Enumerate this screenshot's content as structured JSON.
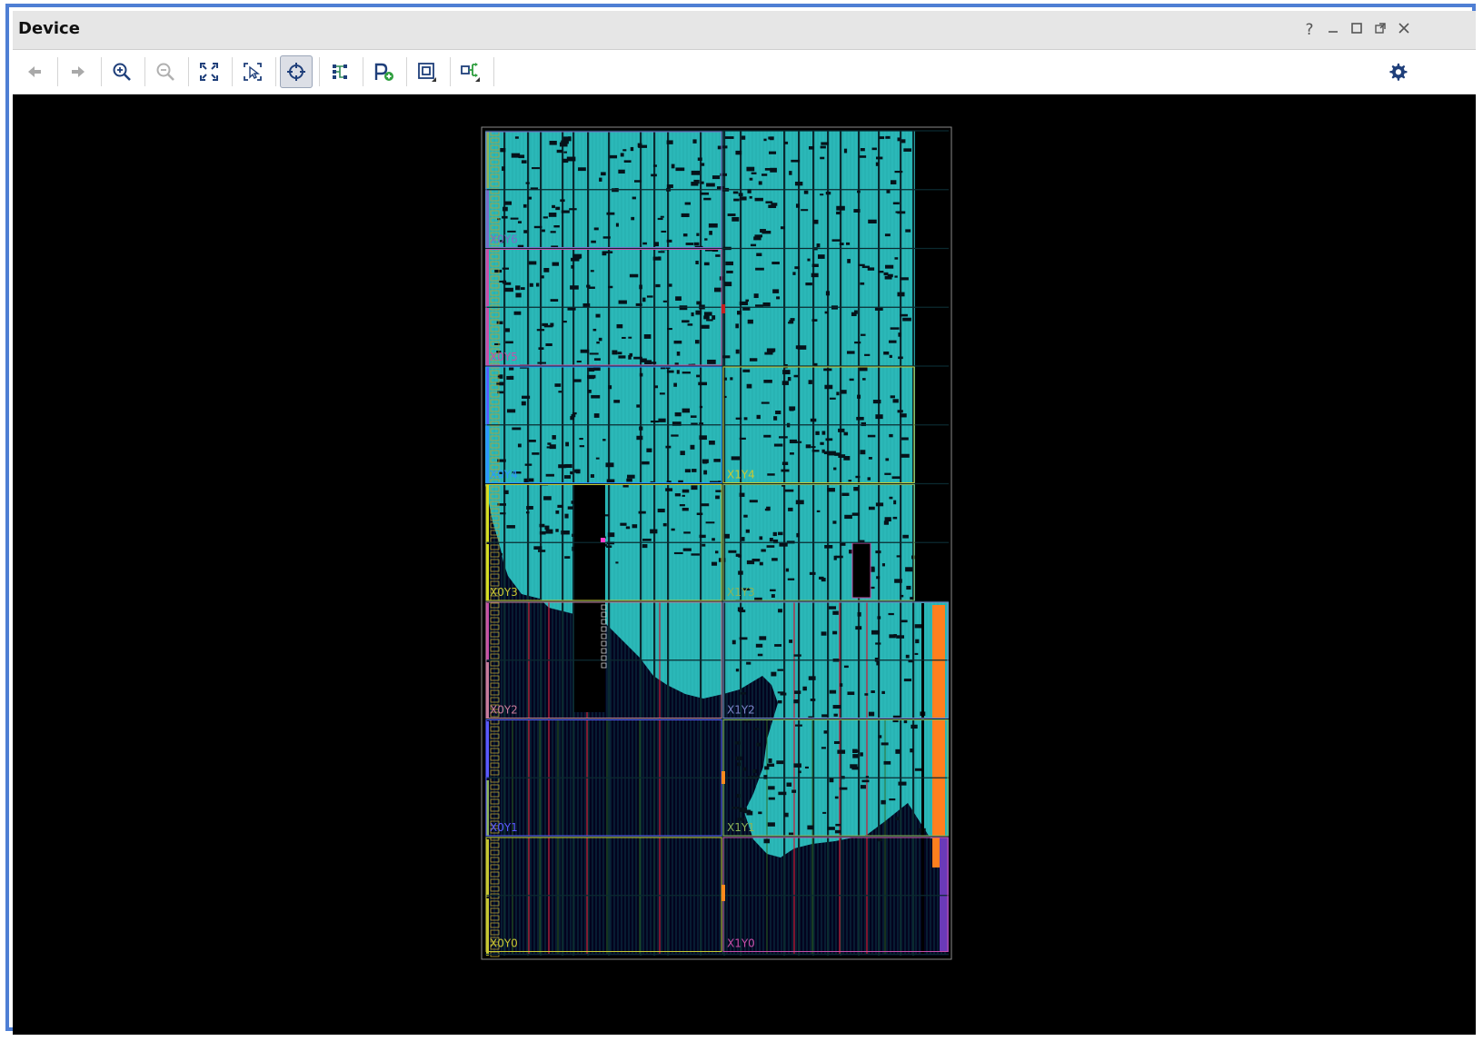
{
  "window": {
    "title": "Device"
  },
  "window_controls": [
    "?",
    "minimize",
    "maximize",
    "restore",
    "close"
  ],
  "toolbar": {
    "buttons": [
      {
        "name": "back-button",
        "icon": "arrow-left-icon",
        "enabled": false
      },
      {
        "name": "forward-button",
        "icon": "arrow-right-icon",
        "enabled": false
      },
      {
        "name": "zoom-in-button",
        "icon": "zoom-in-icon",
        "enabled": true
      },
      {
        "name": "zoom-out-button",
        "icon": "zoom-out-icon",
        "enabled": false
      },
      {
        "name": "zoom-fit-button",
        "icon": "fit-icon",
        "enabled": true
      },
      {
        "name": "zoom-selection-button",
        "icon": "select-zoom-icon",
        "enabled": true
      },
      {
        "name": "auto-fit-selection-button",
        "icon": "crosshair-icon",
        "enabled": true,
        "active": true
      },
      {
        "name": "routing-resources-button",
        "icon": "routing-icon",
        "enabled": true
      },
      {
        "name": "create-pblock-button",
        "icon": "pblock-add-icon",
        "enabled": true
      },
      {
        "name": "cell-view-button",
        "icon": "cell-view-icon",
        "enabled": true
      },
      {
        "name": "net-view-button",
        "icon": "net-view-icon",
        "enabled": true
      }
    ],
    "settings_icon": "gear-icon"
  },
  "device": {
    "colors": {
      "placed_logic": "#2bb8b8",
      "empty_fabric": "#03031e",
      "background": "#000000",
      "io_bank": "#ff7f1e",
      "clock_column_red": "#c2203a"
    },
    "clock_regions": [
      {
        "label": "X0Y0",
        "color": "#c8c832"
      },
      {
        "label": "X1Y0",
        "color": "#c84ea8"
      },
      {
        "label": "X0Y1",
        "color": "#5a5aff"
      },
      {
        "label": "X1Y1",
        "color": "#8cb458"
      },
      {
        "label": "X0Y2",
        "color": "#c87c9c"
      },
      {
        "label": "X1Y2",
        "color": "#7a86c8"
      },
      {
        "label": "X0Y3",
        "color": "#c8c832"
      },
      {
        "label": "X1Y3",
        "color": "#8cb458"
      },
      {
        "label": "X0Y4",
        "color": "#2d97ff"
      },
      {
        "label": "X1Y4",
        "color": "#c8c832"
      },
      {
        "label": "X0Y5",
        "color": "#c84ea8"
      },
      {
        "label": "X0Y6",
        "color": "#7a6cc8"
      }
    ]
  }
}
